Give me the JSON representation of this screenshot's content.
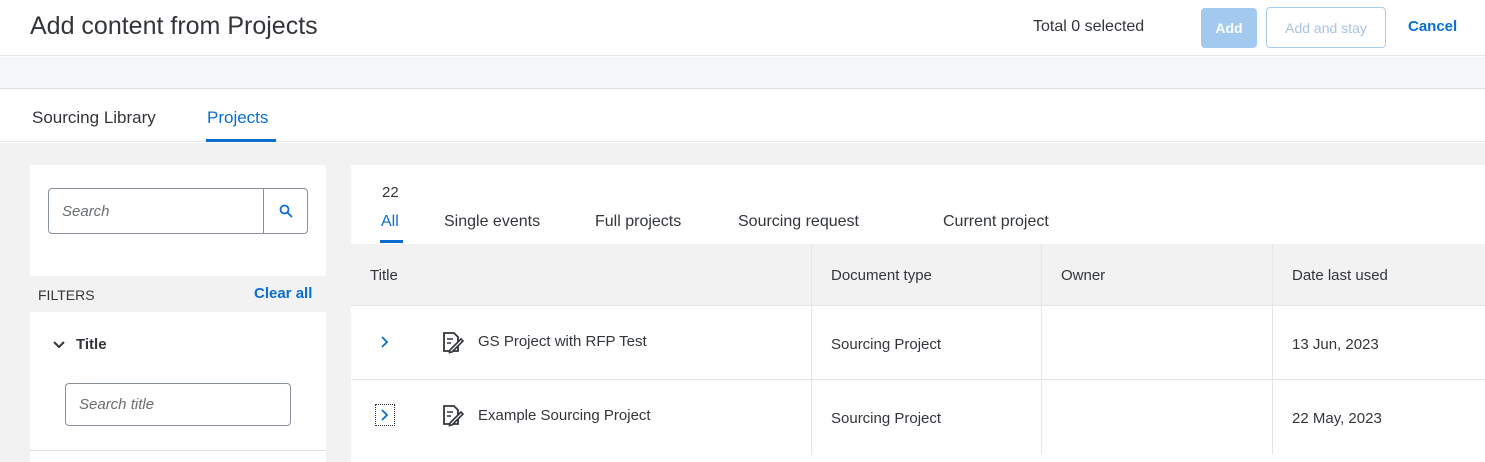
{
  "header": {
    "title": "Add content from Projects",
    "total_selected": "Total 0 selected",
    "add_label": "Add",
    "add_and_stay_label": "Add and stay",
    "cancel_label": "Cancel"
  },
  "tabs": [
    {
      "label": "Sourcing Library",
      "active": false
    },
    {
      "label": "Projects",
      "active": true
    }
  ],
  "filters": {
    "search_placeholder": "Search",
    "filters_label": "FILTERS",
    "clear_all_label": "Clear all",
    "title_filter_label": "Title",
    "title_search_placeholder": "Search title"
  },
  "results": {
    "count": "22",
    "subtabs": [
      {
        "label": "All",
        "active": true
      },
      {
        "label": "Single events",
        "active": false
      },
      {
        "label": "Full projects",
        "active": false
      },
      {
        "label": "Sourcing request",
        "active": false
      },
      {
        "label": "Current project",
        "active": false
      }
    ],
    "columns": [
      "Title",
      "Document type",
      "Owner",
      "Date last used"
    ],
    "rows": [
      {
        "title": "GS Project with RFP Test",
        "document_type": "Sourcing Project",
        "owner": "",
        "date_last_used": "13 Jun, 2023"
      },
      {
        "title": "Example Sourcing Project",
        "document_type": "Sourcing Project",
        "owner": "",
        "date_last_used": "22 May, 2023"
      }
    ]
  },
  "colors": {
    "accent": "#0a6ed1",
    "add_button_disabled": "#a3c9ee",
    "text": "#32363a",
    "panel_background": "#f2f2f2"
  },
  "icons": {
    "search": "search-icon",
    "chevron_down": "chevron-down-icon",
    "chevron_right": "chevron-right-icon",
    "document": "document-edit-icon"
  }
}
